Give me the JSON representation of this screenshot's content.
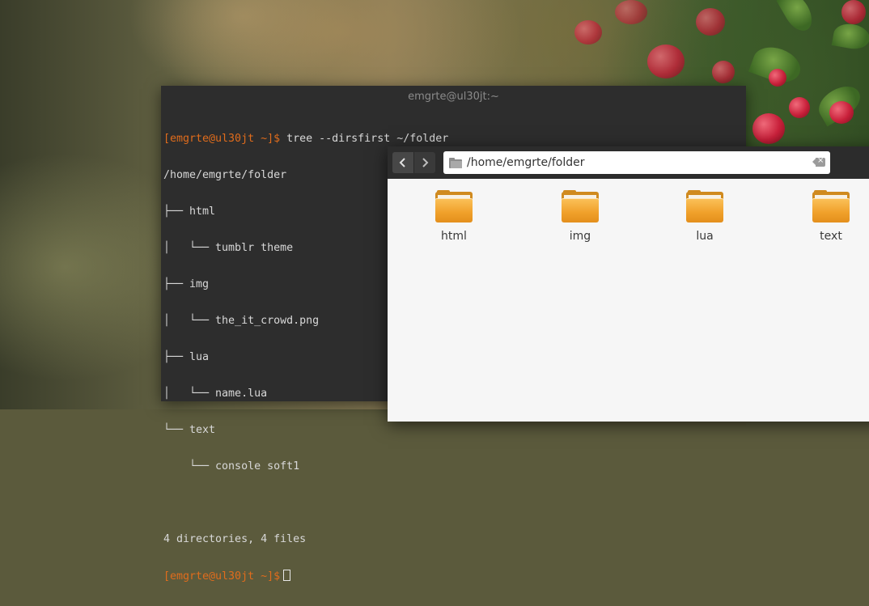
{
  "terminal": {
    "title": "emgrte@ul30jt:~",
    "lines": [
      {
        "prompt": "[emgrte@ul30jt ~]$",
        "text": " tree --dirsfirst ~/folder"
      },
      {
        "prompt": "",
        "text": "/home/emgrte/folder"
      },
      {
        "prompt": "",
        "text": "├── html"
      },
      {
        "prompt": "",
        "text": "│   └── tumblr theme"
      },
      {
        "prompt": "",
        "text": "├── img"
      },
      {
        "prompt": "",
        "text": "│   └── the_it_crowd.png"
      },
      {
        "prompt": "",
        "text": "├── lua"
      },
      {
        "prompt": "",
        "text": "│   └── name.lua"
      },
      {
        "prompt": "",
        "text": "└── text"
      },
      {
        "prompt": "",
        "text": "    └── console soft1"
      },
      {
        "prompt": "",
        "text": ""
      },
      {
        "prompt": "",
        "text": "4 directories, 4 files"
      },
      {
        "prompt": "[emgrte@ul30jt ~]$",
        "text": ""
      }
    ],
    "prompt_color": "#e06c1c"
  },
  "file_manager": {
    "back_icon": "chevron-left-icon",
    "forward_icon": "chevron-right-icon",
    "path": "/home/emgrte/folder",
    "clear_icon": "backspace-clear-icon",
    "items": [
      {
        "label": "html",
        "icon": "folder-icon"
      },
      {
        "label": "img",
        "icon": "folder-icon"
      },
      {
        "label": "lua",
        "icon": "folder-icon"
      },
      {
        "label": "text",
        "icon": "folder-icon"
      }
    ],
    "folder_color": "#f0a02a"
  }
}
